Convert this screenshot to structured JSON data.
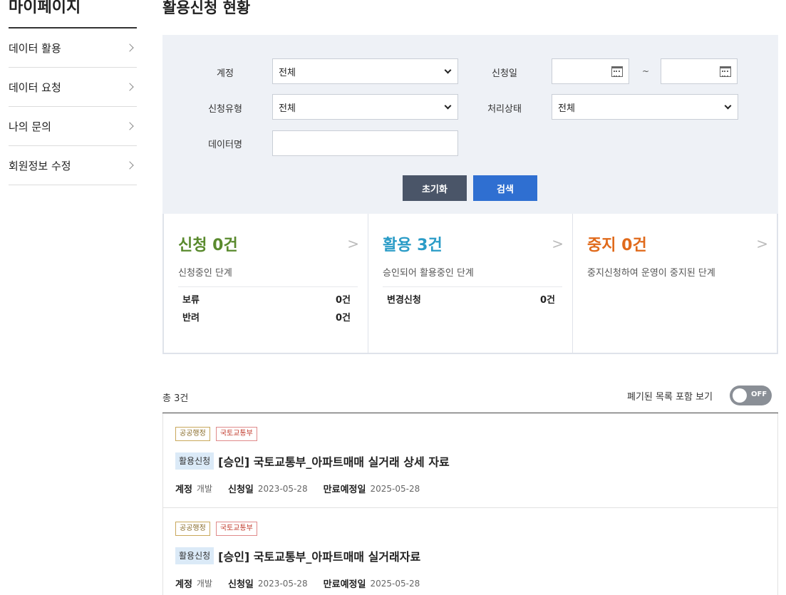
{
  "sidebar": {
    "title": "마이페이지",
    "items": [
      {
        "label": "데이터 활용"
      },
      {
        "label": "데이터 요청"
      },
      {
        "label": "나의 문의"
      },
      {
        "label": "회원정보 수정"
      }
    ]
  },
  "page": {
    "title": "활용신청 현황"
  },
  "filters": {
    "account_label": "계정",
    "account_value": "전체",
    "apply_date_label": "신청일",
    "date_separator": "~",
    "type_label": "신청유형",
    "type_value": "전체",
    "status_label": "처리상태",
    "status_value": "전체",
    "dataname_label": "데이터명",
    "reset_label": "초기화",
    "search_label": "검색"
  },
  "status": {
    "apply": {
      "title": "신청 0건",
      "color": "#5a8a2e",
      "desc": "신청중인 단계",
      "rows": [
        {
          "label": "보류",
          "value": "0건"
        },
        {
          "label": "반려",
          "value": "0건"
        }
      ]
    },
    "use": {
      "title": "활용 3건",
      "color": "#2b9cc7",
      "desc": "승인되어 활용중인 단계",
      "rows": [
        {
          "label": "변경신청",
          "value": "0건"
        }
      ]
    },
    "stop": {
      "title": "중지 0건",
      "color": "#e06a1b",
      "desc": "중지신청하여 운영이 중지된 단계",
      "rows": []
    },
    "arrow": ">"
  },
  "results": {
    "total": "총 3건",
    "toggle_label": "폐기된 목록 포함 보기",
    "toggle_state": "OFF",
    "items": [
      {
        "tag1": "공공행정",
        "tag2": "국토교통부",
        "badge": "활용신청",
        "title": "[승인] 국토교통부_아파트매매 실거래 상세 자료",
        "account_key": "계정",
        "account_val": "개발",
        "applied_key": "신청일",
        "applied_val": "2023-05-28",
        "expire_key": "만료예정일",
        "expire_val": "2025-05-28"
      },
      {
        "tag1": "공공행정",
        "tag2": "국토교통부",
        "badge": "활용신청",
        "title": "[승인] 국토교통부_아파트매매 실거래자료",
        "account_key": "계정",
        "account_val": "개발",
        "applied_key": "신청일",
        "applied_val": "2023-05-28",
        "expire_key": "만료예정일",
        "expire_val": "2025-05-28"
      }
    ]
  }
}
